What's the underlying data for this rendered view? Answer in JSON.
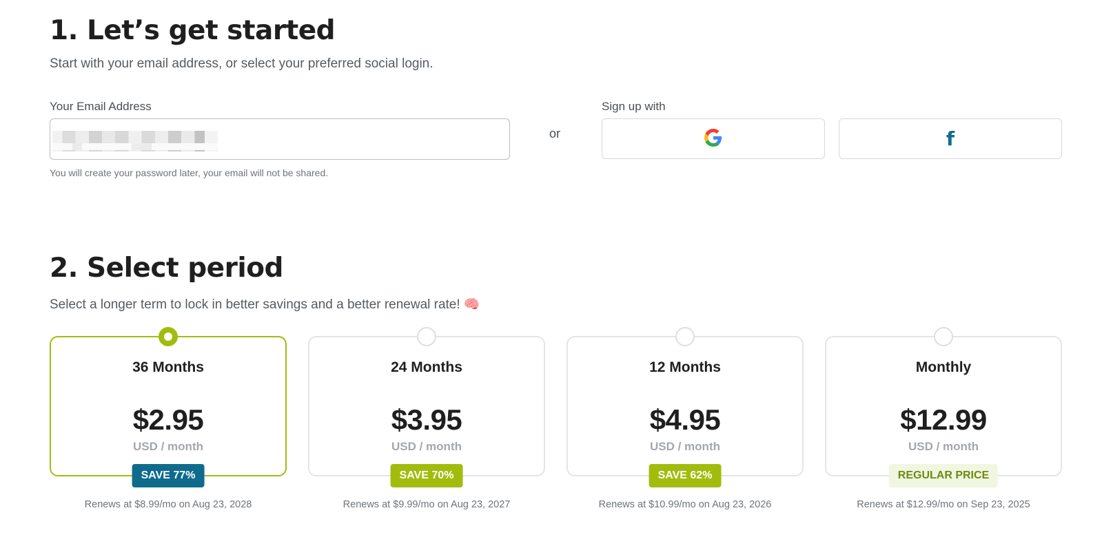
{
  "step1": {
    "title": "1. Let’s get started",
    "subtitle": "Start with your email address, or select your preferred social login.",
    "email_label": "Your Email Address",
    "email_value": "",
    "hint": "You will create your password later, your email will not be shared.",
    "or_text": "or",
    "signup_label": "Sign up with",
    "google_icon": "google-icon",
    "facebook_icon": "facebook-icon",
    "facebook_glyph": "f"
  },
  "step2": {
    "title": "2. Select period",
    "subtitle": "Select a longer term to lock in better savings and a better renewal rate! 🧠",
    "plans": [
      {
        "name": "36 Months",
        "price": "$2.95",
        "unit": "USD / month",
        "badge": "SAVE 77%",
        "renew": "Renews at $8.99/mo on Aug 23, 2028",
        "selected": true
      },
      {
        "name": "24 Months",
        "price": "$3.95",
        "unit": "USD / month",
        "badge": "SAVE 70%",
        "renew": "Renews at $9.99/mo on Aug 23, 2027",
        "selected": false
      },
      {
        "name": "12 Months",
        "price": "$4.95",
        "unit": "USD / month",
        "badge": "SAVE 62%",
        "renew": "Renews at $10.99/mo on Aug 23, 2026",
        "selected": false
      },
      {
        "name": "Monthly",
        "price": "$12.99",
        "unit": "USD / month",
        "badge": "REGULAR PRICE",
        "renew": "Renews at $12.99/mo on Sep 23, 2025",
        "selected": false
      }
    ]
  },
  "colors": {
    "accent_green": "#a2bc0e",
    "badge_blue": "#0e6b8c",
    "facebook_blue": "#0e6d8f"
  }
}
